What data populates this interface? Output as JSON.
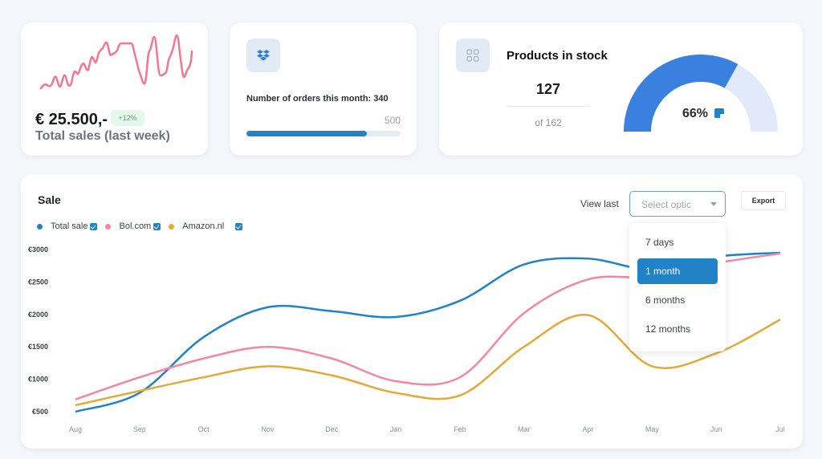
{
  "sales_card": {
    "amount": "€ 25.500,-",
    "badge": "+12%",
    "label": "Total sales (last week)",
    "sparkline_color": "#f2778f"
  },
  "orders_card": {
    "icon": "dropbox-icon",
    "label": "Number of orders this month: 340",
    "value": 340,
    "max_label": "500",
    "max": 500,
    "progress_fraction": 0.78
  },
  "stock_card": {
    "icon": "grid-icon",
    "title": "Products in stock",
    "count": "127",
    "of_label": "of 162",
    "gauge_label": "66%",
    "gauge_percent": 66,
    "colors": {
      "fill": "#3a80de",
      "track": "#e1e9fb"
    }
  },
  "sale_panel": {
    "title": "Sale",
    "view_last_label": "View last",
    "select_placeholder": "Select optic",
    "export_label": "Export",
    "dropdown_options": [
      {
        "label": "7 days",
        "active": false
      },
      {
        "label": "1 month",
        "active": true
      },
      {
        "label": "6 months",
        "active": false
      },
      {
        "label": "12 months",
        "active": false
      }
    ]
  },
  "chart_data": {
    "type": "line",
    "title": "Sale",
    "xlabel": "",
    "ylabel": "",
    "categories": [
      "Aug",
      "Sep",
      "Oct",
      "Nov",
      "Dec",
      "Jan",
      "Feb",
      "Mar",
      "Apr",
      "May",
      "Jun",
      "Jul"
    ],
    "yticks": [
      "€500",
      "€1000",
      "€1500",
      "€2000",
      "€2500",
      "€3000"
    ],
    "ytick_values": [
      500,
      1000,
      1500,
      2000,
      2500,
      3000
    ],
    "ylim": [
      500,
      3000
    ],
    "grid": false,
    "legend_position": "top-left",
    "series": [
      {
        "name": "Total sale",
        "color": "#2282c8",
        "checked": true,
        "values": [
          500,
          790,
          1650,
          2110,
          2050,
          1960,
          2210,
          2770,
          2860,
          2690,
          2890,
          2950
        ]
      },
      {
        "name": "Bol.com",
        "color": "#f486a4",
        "checked": true,
        "values": [
          690,
          1030,
          1320,
          1500,
          1320,
          970,
          1030,
          2020,
          2540,
          2580,
          2790,
          2940
        ]
      },
      {
        "name": "Amazon.nl",
        "color": "#e5a935",
        "checked": true,
        "values": [
          600,
          820,
          1030,
          1200,
          1060,
          790,
          750,
          1500,
          1990,
          1200,
          1400,
          1920
        ]
      }
    ]
  }
}
